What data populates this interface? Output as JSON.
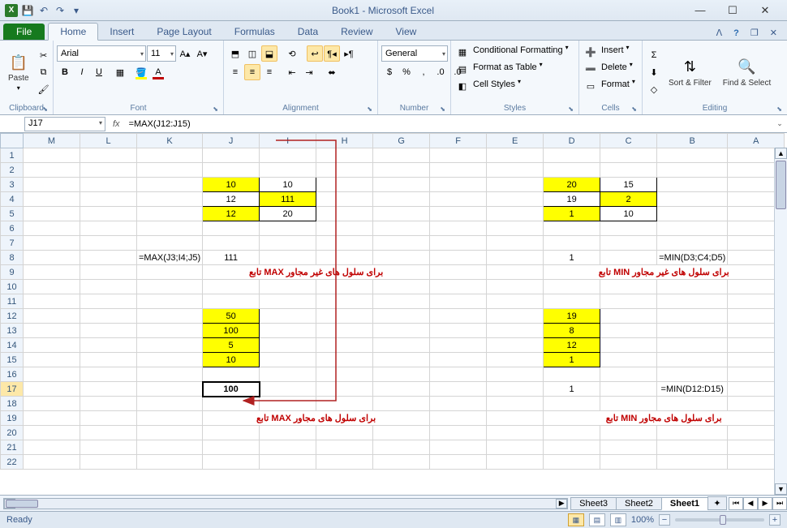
{
  "title": "Book1 - Microsoft Excel",
  "qat": {
    "save": "💾",
    "undo": "↶",
    "redo": "↷"
  },
  "tabs": {
    "file": "File",
    "home": "Home",
    "insert": "Insert",
    "page_layout": "Page Layout",
    "formulas": "Formulas",
    "data": "Data",
    "review": "Review",
    "view": "View"
  },
  "ribbon": {
    "clipboard": {
      "label": "Clipboard",
      "paste": "Paste"
    },
    "font": {
      "label": "Font",
      "name": "Arial",
      "size": "11",
      "bold": "B",
      "italic": "I",
      "underline": "U"
    },
    "alignment": {
      "label": "Alignment",
      "wrap": "Wrap Text",
      "merge": "Merge & Center"
    },
    "number": {
      "label": "Number",
      "format": "General"
    },
    "styles": {
      "label": "Styles",
      "cond": "Conditional Formatting",
      "table": "Format as Table",
      "cell": "Cell Styles"
    },
    "cells": {
      "label": "Cells",
      "insert": "Insert",
      "delete": "Delete",
      "format": "Format"
    },
    "editing": {
      "label": "Editing",
      "sort": "Sort & Filter",
      "find": "Find & Select",
      "sortLine2": "Filter",
      "findLine2": "Select"
    }
  },
  "namebox": "J17",
  "formula": "=MAX(J12:J15)",
  "columns": [
    "M",
    "L",
    "K",
    "J",
    "I",
    "H",
    "G",
    "F",
    "E",
    "D",
    "C",
    "B",
    "A"
  ],
  "rows": [
    1,
    2,
    3,
    4,
    5,
    6,
    7,
    8,
    9,
    10,
    11,
    12,
    13,
    14,
    15,
    16,
    17,
    18,
    19,
    20,
    21,
    22
  ],
  "cells": {
    "r3": {
      "J": {
        "v": "10",
        "y": true,
        "b": true
      },
      "I": {
        "v": "10",
        "b": true
      },
      "D": {
        "v": "20",
        "y": true,
        "b": true
      },
      "C": {
        "v": "15",
        "b": true
      }
    },
    "r4": {
      "J": {
        "v": "12",
        "b": true
      },
      "I": {
        "v": "111",
        "y": true,
        "b": true
      },
      "D": {
        "v": "19",
        "b": true
      },
      "C": {
        "v": "2",
        "y": true,
        "b": true
      }
    },
    "r5": {
      "J": {
        "v": "12",
        "y": true,
        "b": true
      },
      "I": {
        "v": "20",
        "b": true
      },
      "D": {
        "v": "1",
        "y": true,
        "b": true
      },
      "C": {
        "v": "10",
        "b": true
      }
    },
    "r8": {
      "K": {
        "v": "=MAX(J3;I4;J5)"
      },
      "J": {
        "v": "111"
      },
      "D": {
        "v": "1"
      },
      "B": {
        "v": "=MIN(D3;C4;D5)"
      }
    },
    "r9": {
      "J": {
        "v": "تابع MAX برای سلول های غیر مجاور",
        "red": true,
        "span": 4
      },
      "D": {
        "v": "تابع MIN برای سلول های غیر مجاور",
        "red": true,
        "span": 4
      }
    },
    "r12": {
      "J": {
        "v": "50",
        "y": true,
        "b": true
      },
      "D": {
        "v": "19",
        "y": true,
        "b": true
      }
    },
    "r13": {
      "J": {
        "v": "100",
        "y": true,
        "b": true
      },
      "D": {
        "v": "8",
        "y": true,
        "b": true
      }
    },
    "r14": {
      "J": {
        "v": "5",
        "y": true,
        "b": true
      },
      "D": {
        "v": "12",
        "y": true,
        "b": true
      }
    },
    "r15": {
      "J": {
        "v": "10",
        "y": true,
        "b": true
      },
      "D": {
        "v": "1",
        "y": true,
        "b": true
      }
    },
    "r17": {
      "J": {
        "v": "100",
        "sel": true
      },
      "D": {
        "v": "1"
      },
      "B": {
        "v": "=MIN(D12:D15)"
      }
    },
    "r19": {
      "J": {
        "v": "تابع MAX برای سلول های مجاور",
        "red": true,
        "span": 4
      },
      "D": {
        "v": "تابع MIN برای سلول های مجاور",
        "red": true,
        "span": 4
      }
    }
  },
  "sheets": {
    "s1": "Sheet1",
    "s2": "Sheet2",
    "s3": "Sheet3"
  },
  "status": {
    "ready": "Ready",
    "zoom": "100%"
  }
}
